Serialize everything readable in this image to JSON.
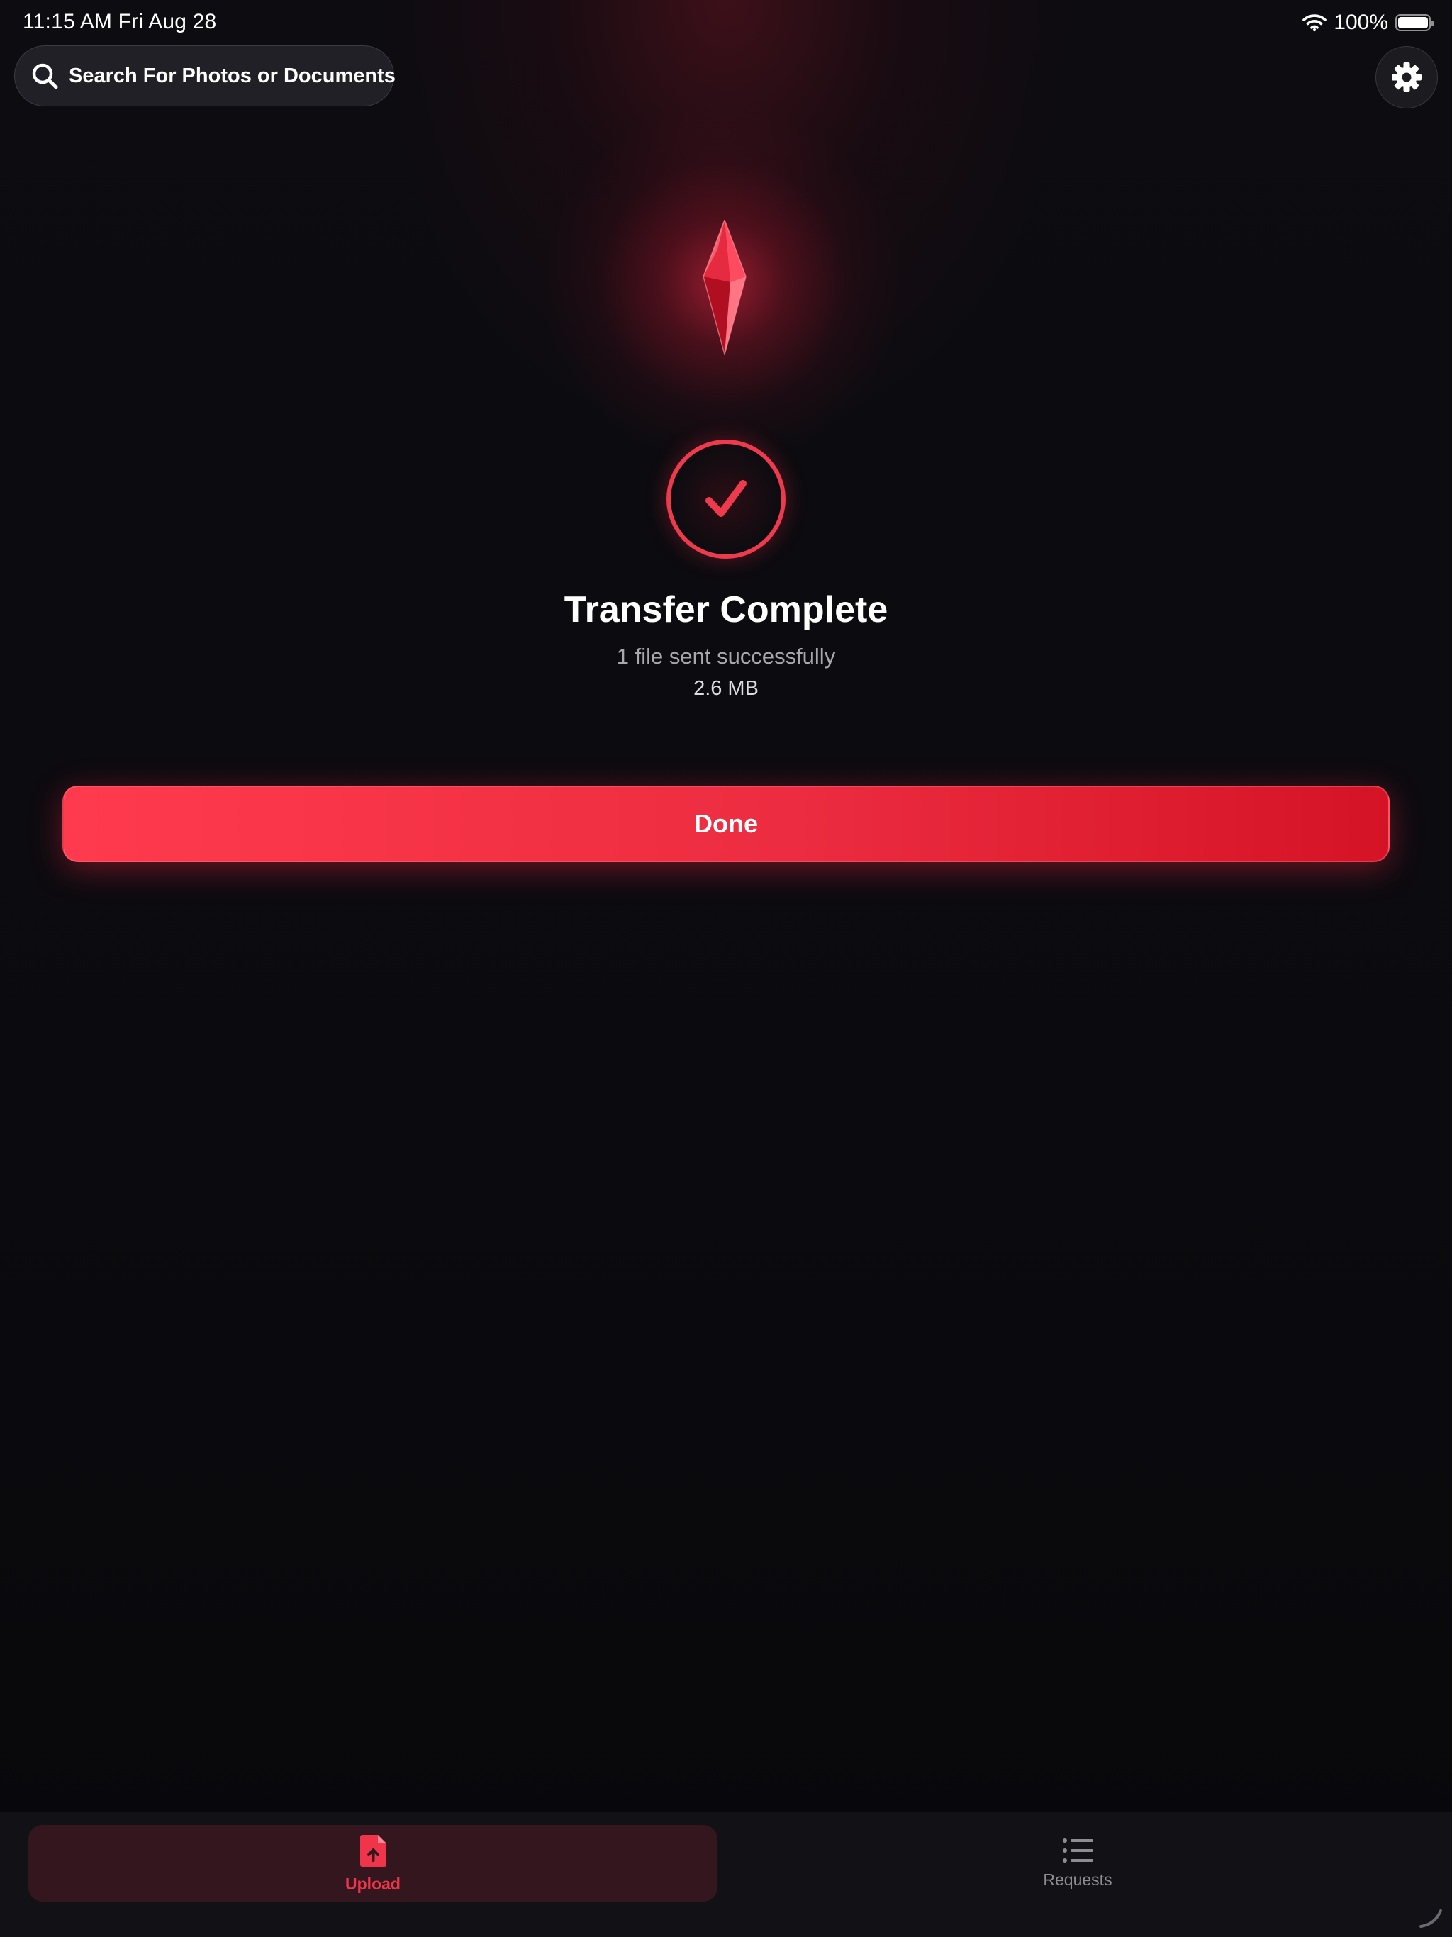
{
  "status_bar": {
    "time": "11:15 AM   Fri Aug 28",
    "battery": "100%"
  },
  "search": {
    "placeholder": "Search For Photos or Documents"
  },
  "main": {
    "title": "Transfer Complete",
    "subtitle": "1 file sent successfully",
    "file_size": "2.6 MB",
    "done_label": "Done"
  },
  "tabs": [
    {
      "label": "Upload",
      "icon": "file-upload-icon",
      "active": true
    },
    {
      "label": "Requests",
      "icon": "list-icon",
      "active": false
    }
  ],
  "colors": {
    "accent": "#f0354a",
    "done_start": "#ff3a4e",
    "done_end": "#d51326",
    "background": "#0a0a0e"
  }
}
